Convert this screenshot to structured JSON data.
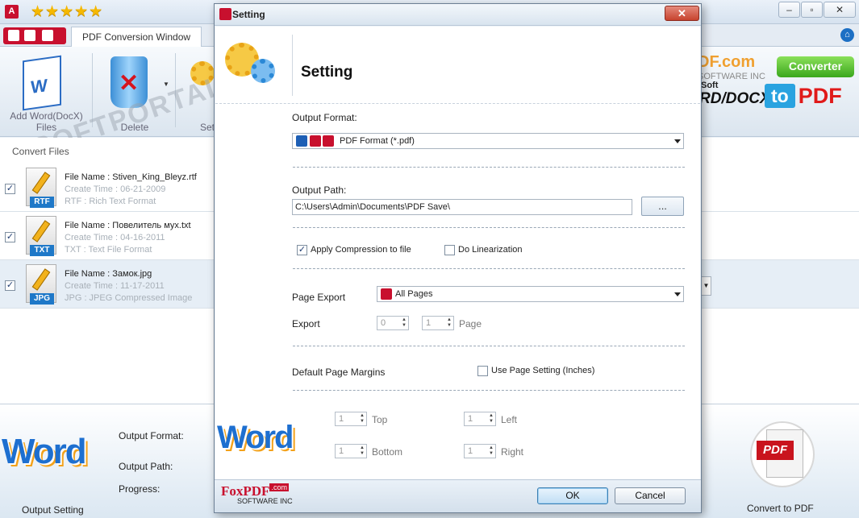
{
  "main": {
    "stars": "★★★★★",
    "tab_label": "PDF Conversion Window",
    "toolbar": {
      "add_label": "Add Word(DocX) Files",
      "delete_label": "Delete",
      "setting_label": "Set"
    },
    "brand": {
      "company": "DF.com",
      "company_sub": "SOFTWARE INC",
      "soft": "Soft",
      "product": "RD/DOCX",
      "converter_badge": "Converter",
      "to": "to",
      "pdf": "PDF"
    },
    "watermark": "SOFTPORTAL",
    "list_title": "Convert Files",
    "files": [
      {
        "name": "File Name : Stiven_King_Bleyz.rtf",
        "created": "Create Time : 06-21-2009",
        "type": "RTF : Rich Text Format",
        "ext": "RTF"
      },
      {
        "name": "File Name : Повелитель мух.txt",
        "created": "Create Time : 04-16-2011",
        "type": "TXT : Text File Format",
        "ext": "TXT"
      },
      {
        "name": "File Name : Замок.jpg",
        "created": "Create Time : 11-17-2011",
        "type": "JPG : JPEG Compressed Image",
        "ext": "JPG"
      }
    ],
    "bottom": {
      "output_format_label": "Output Format:",
      "output_path_label": "Output Path:",
      "progress_label": "Progress:",
      "output_setting": "Output Setting",
      "convert_to_pdf": "Convert to PDF",
      "pdf_tag": "PDF"
    },
    "word_art": "Word"
  },
  "dialog": {
    "title": "Setting",
    "close": "✕",
    "header_title": "Setting",
    "output_format_label": "Output Format:",
    "output_format_value": "PDF Format (*.pdf)",
    "output_path_label": "Output Path:",
    "output_path_value": "C:\\Users\\Admin\\Documents\\PDF Save\\",
    "browse_label": "...",
    "apply_compression": "Apply Compression to file",
    "do_linearization": "Do Linearization",
    "page_export_label": "Page Export",
    "page_export_value": "All Pages",
    "export_label": "Export",
    "export_from": "0",
    "export_to": "1",
    "page_label": "Page",
    "margins_label": "Default Page Margins",
    "use_page_setting": "Use Page Setting (Inches)",
    "top_label": "Top",
    "left_label": "Left",
    "bottom_label": "Bottom",
    "right_label": "Right",
    "top_value": "1",
    "left_value": "1",
    "bottom_value": "1",
    "right_value": "1",
    "ok": "OK",
    "cancel": "Cancel",
    "logo_fox": "FoxPDF",
    "logo_com": ".com",
    "logo_software": "SOFTWARE INC"
  },
  "colors": {
    "accent_blue": "#1e78c8",
    "brand_red": "#c8102e",
    "star_gold": "#f5b800",
    "badge_green": "#3aa71c"
  },
  "icons": [
    "app-pdf-icon",
    "star-icon",
    "home-icon",
    "word-doc-icon",
    "trash-icon",
    "gear-icon",
    "pdf-file-icon",
    "close-icon",
    "chevron-down-icon"
  ]
}
